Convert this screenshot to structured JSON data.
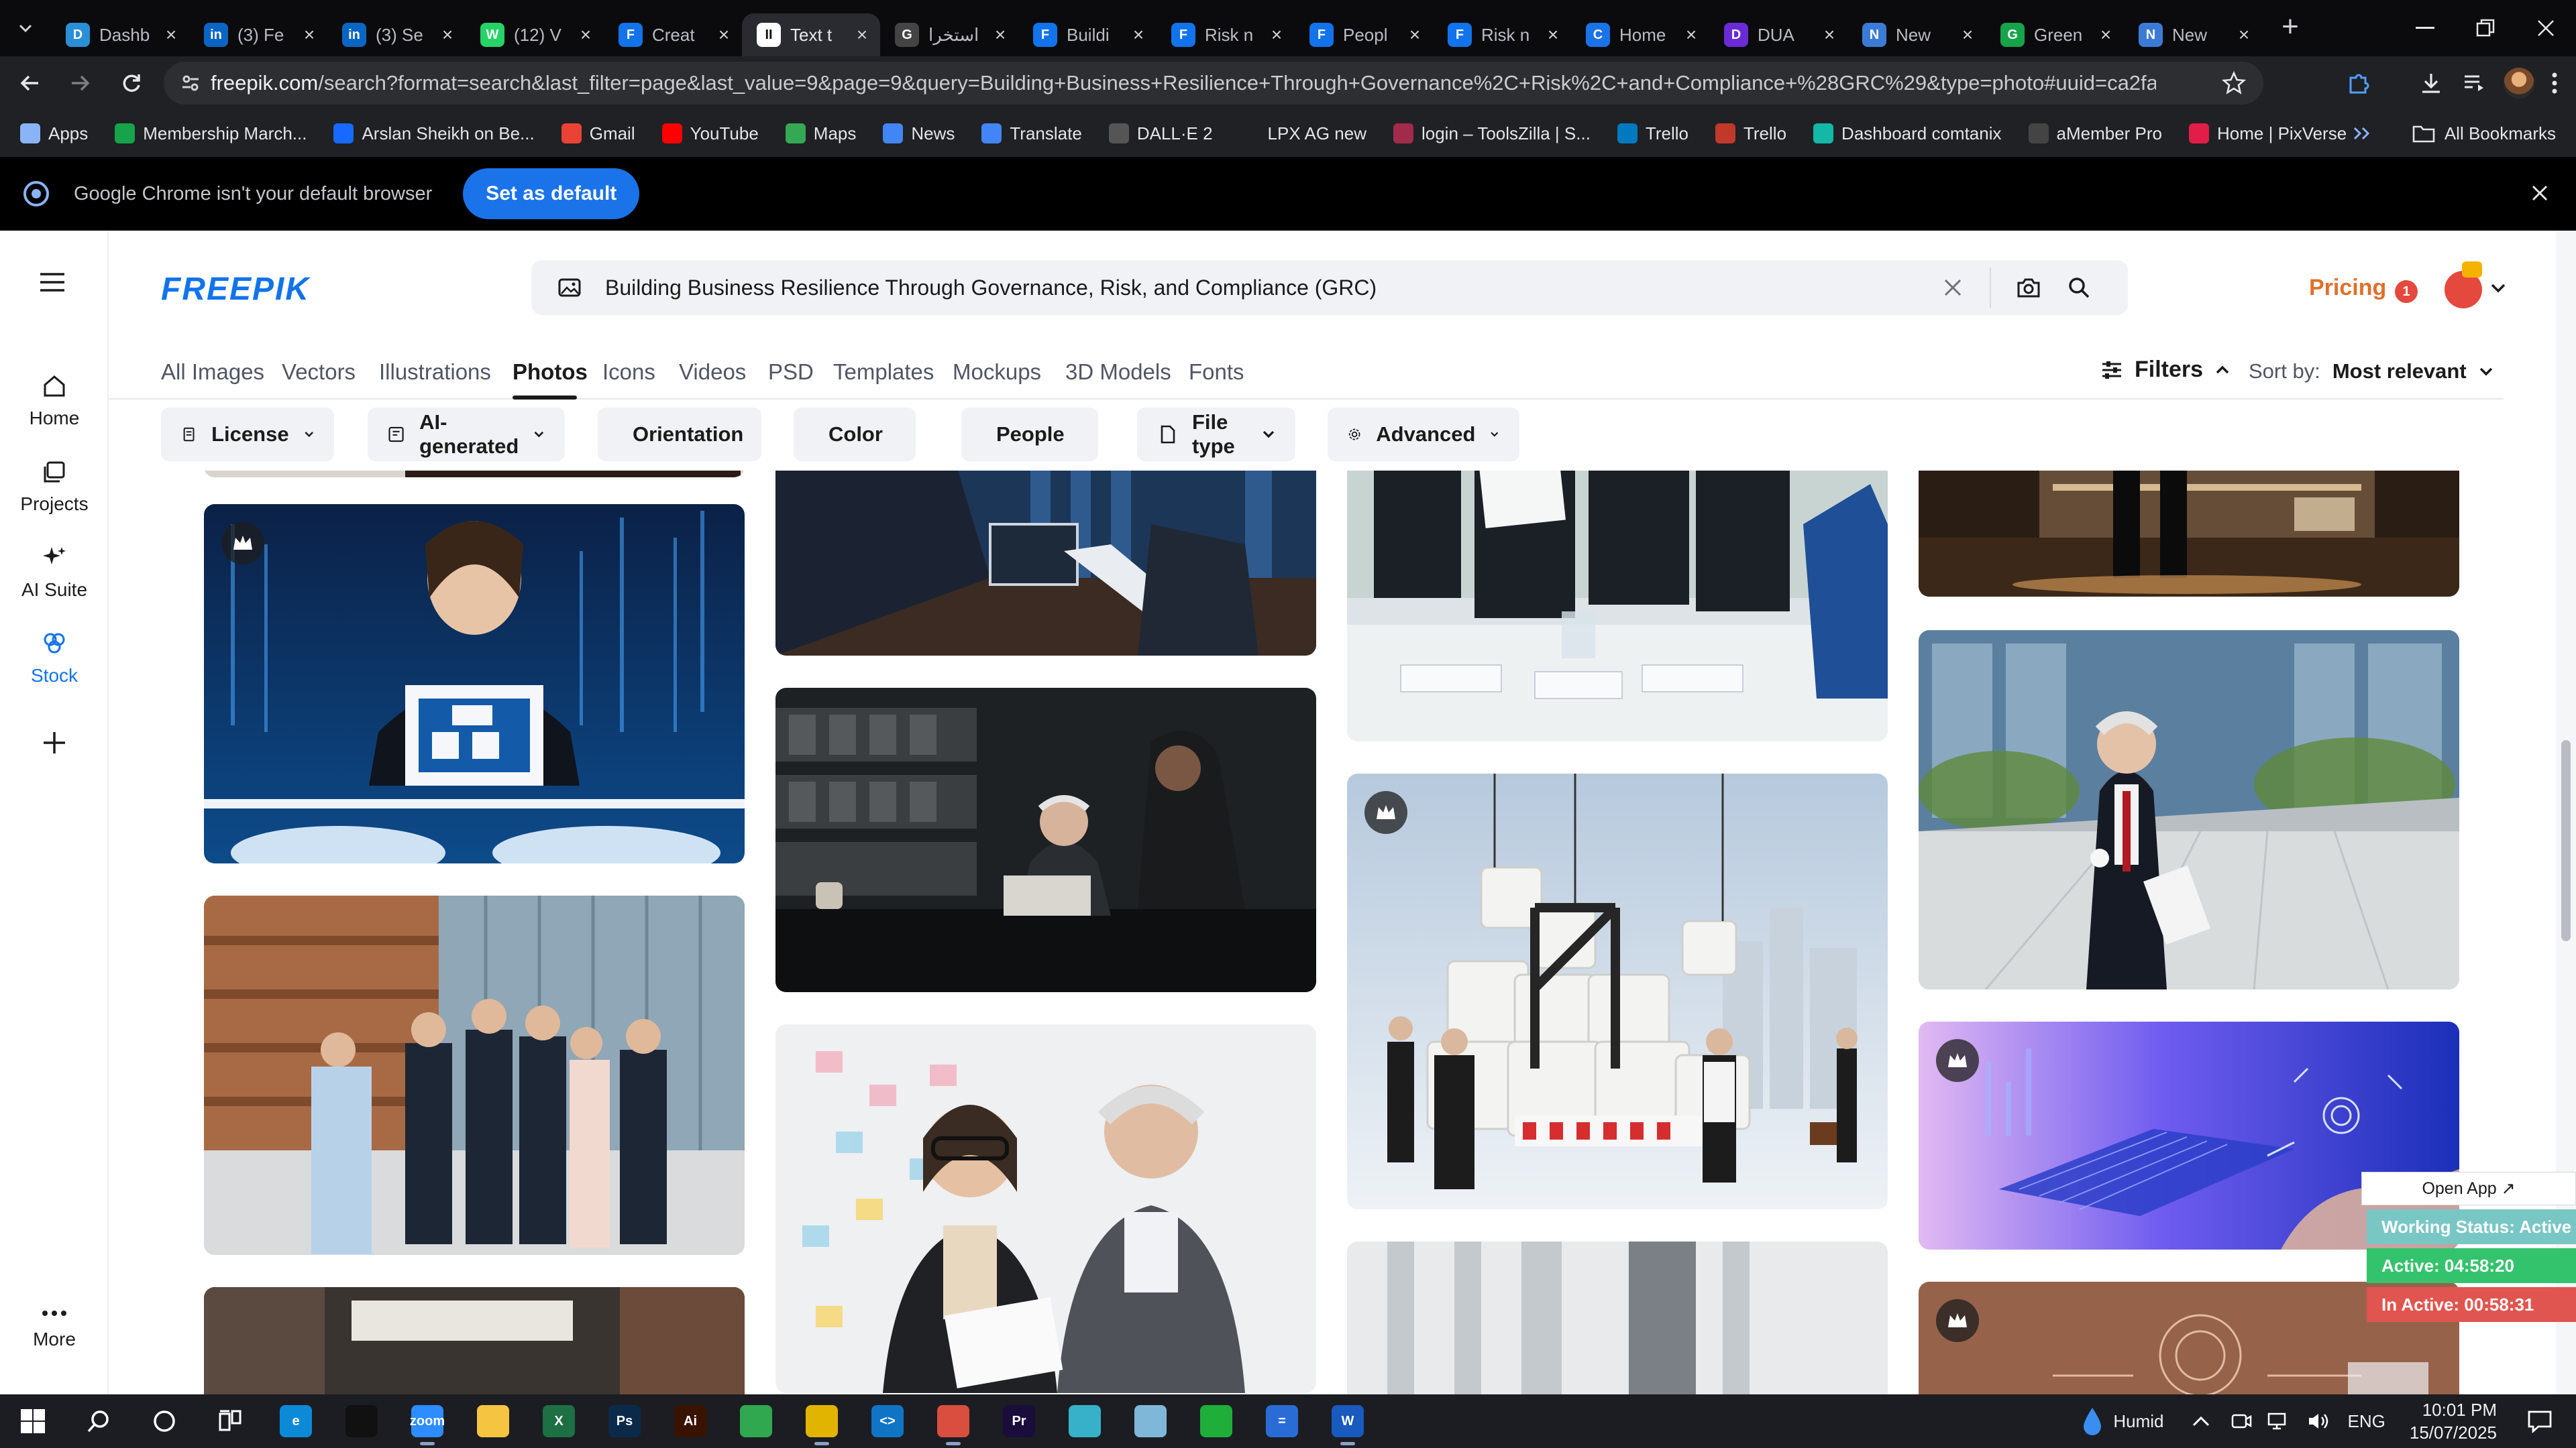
{
  "browser": {
    "tabs": [
      {
        "title": "Dashb",
        "icon_color": "#2b8fd6",
        "icon": "D"
      },
      {
        "title": "(3) Fe",
        "icon_color": "#0a66c2",
        "icon": "in"
      },
      {
        "title": "(3) Se",
        "icon_color": "#0a66c2",
        "icon": "in"
      },
      {
        "title": "(12) V",
        "icon_color": "#25d366",
        "icon": "W"
      },
      {
        "title": "Creat",
        "icon_color": "#1273eb",
        "icon": "F"
      },
      {
        "title": "Text t",
        "icon_color": "#ffffff",
        "icon": "II",
        "active": true
      },
      {
        "title": "استخرا",
        "icon_color": "#444",
        "icon": "G"
      },
      {
        "title": "Buildi",
        "icon_color": "#1273eb",
        "icon": "F"
      },
      {
        "title": "Risk n",
        "icon_color": "#1273eb",
        "icon": "F"
      },
      {
        "title": "Peopl",
        "icon_color": "#1273eb",
        "icon": "F"
      },
      {
        "title": "Risk n",
        "icon_color": "#1273eb",
        "icon": "F"
      },
      {
        "title": "Home",
        "icon_color": "#1a73e8",
        "icon": "C"
      },
      {
        "title": "DUA",
        "icon_color": "#6a2bd6",
        "icon": "D"
      },
      {
        "title": "New",
        "icon_color": "#3b7bd6",
        "icon": "N"
      },
      {
        "title": "Green",
        "icon_color": "#17a34a",
        "icon": "G"
      },
      {
        "title": "New",
        "icon_color": "#3b7bd6",
        "icon": "N"
      }
    ],
    "url_domain": "freepik.com",
    "url_rest": "/search?format=search&last_filter=page&last_value=9&page=9&query=Building+Business+Resilience+Through+Governance%2C+Risk%2C+and+Compliance+%28GRC%29&type=photo#uuid=ca2fac46-376d-4ca8-8abf-f91f3712...",
    "bookmarks": [
      {
        "label": "Apps",
        "icon": "apps-grid-icon",
        "color": "#8ab4f8"
      },
      {
        "label": "Membership March...",
        "icon": "membership-icon",
        "color": "#16a34a"
      },
      {
        "label": "Arslan Sheikh on Be...",
        "icon": "behance-icon",
        "color": "#1769ff"
      },
      {
        "label": "Gmail",
        "icon": "gmail-icon",
        "color": "#ea4335"
      },
      {
        "label": "YouTube",
        "icon": "youtube-icon",
        "color": "#ff0000"
      },
      {
        "label": "Maps",
        "icon": "maps-icon",
        "color": "#34a853"
      },
      {
        "label": "News",
        "icon": "news-icon",
        "color": "#4285f4"
      },
      {
        "label": "Translate",
        "icon": "translate-icon",
        "color": "#4285f4"
      },
      {
        "label": "DALL·E 2",
        "icon": "openai-icon",
        "color": "#555"
      },
      {
        "label": "LPX AG new",
        "icon": "lpx-icon",
        "color": "#202124"
      },
      {
        "label": "login – ToolsZilla | S...",
        "icon": "toolszilla-icon",
        "color": "#a12b4b"
      },
      {
        "label": "Trello",
        "icon": "trello-icon",
        "color": "#0079bf"
      },
      {
        "label": "Trello",
        "icon": "trello-icon",
        "color": "#c0392b"
      },
      {
        "label": "Dashboard comtanix",
        "icon": "comtanix-icon",
        "color": "#14b8a6"
      },
      {
        "label": "aMember Pro",
        "icon": "amember-icon",
        "color": "#444"
      },
      {
        "label": "Home | PixVerse",
        "icon": "pixverse-icon",
        "color": "#e11d48"
      }
    ],
    "all_bookmarks": "All Bookmarks",
    "infobar_text": "Google Chrome isn't your default browser",
    "infobar_button": "Set as default"
  },
  "sidebar": {
    "items": [
      {
        "label": "Home",
        "icon": "home-icon"
      },
      {
        "label": "Projects",
        "icon": "projects-icon"
      },
      {
        "label": "AI Suite",
        "icon": "ai-suite-icon"
      },
      {
        "label": "Stock",
        "icon": "stock-icon",
        "active": true
      }
    ],
    "more": "More"
  },
  "header": {
    "logo": "FREEPIK",
    "search_query": "Building Business Resilience Through Governance, Risk, and Compliance (GRC)",
    "pricing": "Pricing",
    "notification_count": "1"
  },
  "type_tabs": [
    "All Images",
    "Vectors",
    "Illustrations",
    "Photos",
    "Icons",
    "Videos",
    "PSD",
    "Templates",
    "Mockups",
    "3D Models",
    "Fonts"
  ],
  "active_type_tab": "Photos",
  "filters_label": "Filters",
  "sort": {
    "label": "Sort by:",
    "value": "Most relevant"
  },
  "chips": [
    {
      "label": "License",
      "icon": "license-icon"
    },
    {
      "label": "AI-generated",
      "icon": "ai-generated-icon"
    },
    {
      "label": "Orientation",
      "icon": "orientation-icon"
    },
    {
      "label": "Color",
      "icon": "color-icon"
    },
    {
      "label": "People",
      "icon": "people-icon"
    },
    {
      "label": "File type",
      "icon": "file-type-icon"
    },
    {
      "label": "Advanced",
      "icon": "advanced-icon"
    }
  ],
  "widget": {
    "open_app": "Open App ↗",
    "status": "Working Status: Active",
    "active": "Active: 04:58:20",
    "inactive": "In Active: 00:58:31"
  },
  "taskbar": {
    "weather": "Humid",
    "language": "ENG",
    "time": "10:01 PM",
    "date": "15/07/2025"
  }
}
